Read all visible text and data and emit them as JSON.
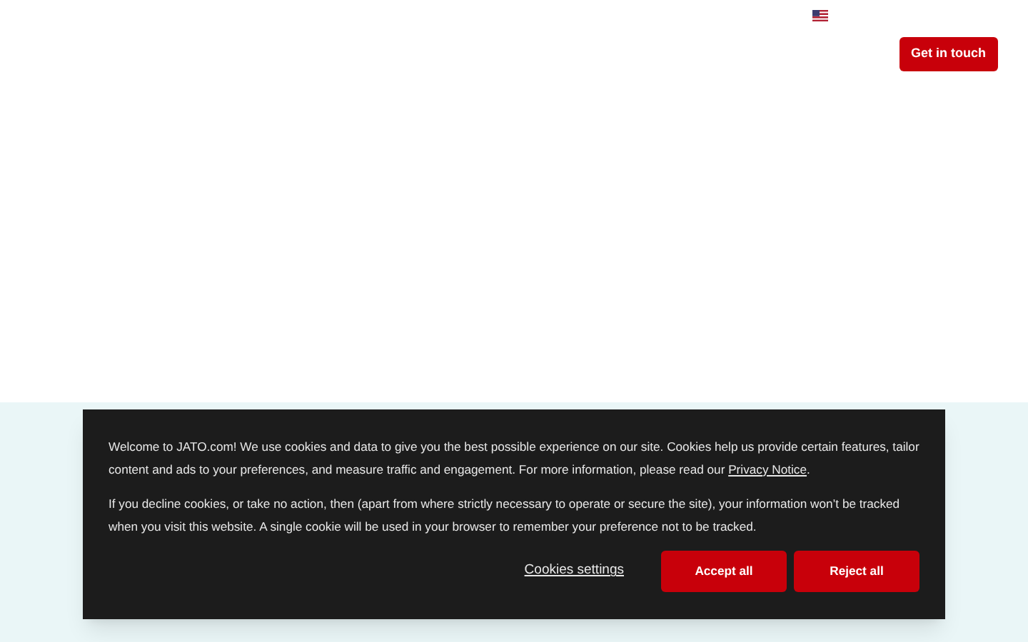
{
  "header": {
    "cta": "Get in touch"
  },
  "cookie_banner": {
    "paragraphs": [
      {
        "text": "Welcome to JATO.com! We use cookies and data to give you the best possible experience on our site. Cookies help us provide certain features, tailor content and ads to your preferences, and measure traffic and engagement. For more information, please read our ",
        "link": "Privacy Notice",
        "after": "."
      },
      {
        "text": "If you decline cookies, or take no action, then (apart from where strictly necessary to operate or secure the site), your information won’t be tracked when you visit this website. A single cookie will be used in your browser to remember your preference not to be tracked."
      }
    ],
    "settings_link": "Cookies settings",
    "buttons": [
      "Accept all",
      "Reject all"
    ]
  }
}
